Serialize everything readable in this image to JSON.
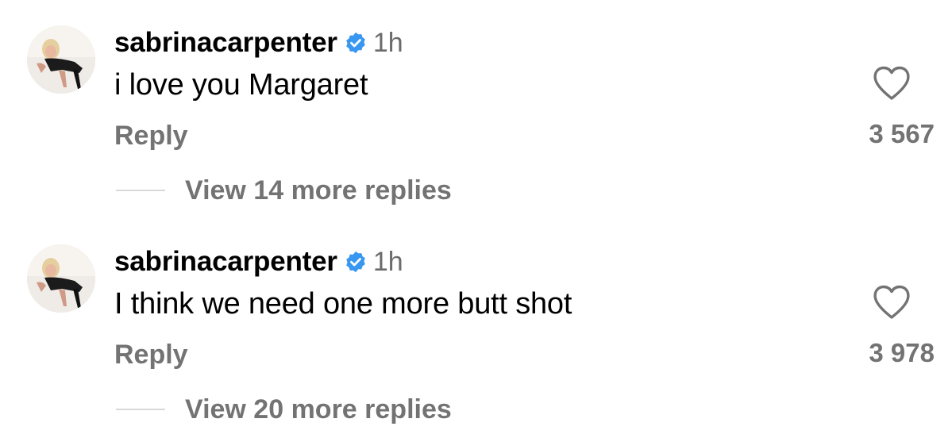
{
  "comments": [
    {
      "username": "sabrinacarpenter",
      "verified": true,
      "time": "1h",
      "text": "i love you Margaret",
      "reply_label": "Reply",
      "likes": "3 567",
      "view_replies": "View 14 more replies",
      "like_icon": "heart-outline-icon",
      "avatar_icon": "profile-photo"
    },
    {
      "username": "sabrinacarpenter",
      "verified": true,
      "time": "1h",
      "text": "I think we need one more butt shot",
      "reply_label": "Reply",
      "likes": "3 978",
      "view_replies": "View 20 more replies",
      "like_icon": "heart-outline-icon",
      "avatar_icon": "profile-photo"
    }
  ],
  "colors": {
    "verified": "#3897f0",
    "secondary_text": "#737373",
    "timestamp": "#6b6b6b",
    "primary_text": "#000000",
    "divider": "#d9d9d9"
  }
}
